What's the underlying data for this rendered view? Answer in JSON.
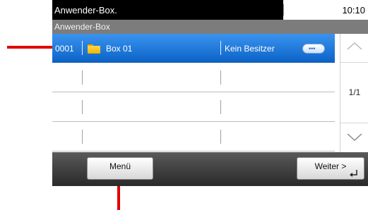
{
  "status": {
    "title": "Anwender-Box.",
    "time": "10:10"
  },
  "breadcrumb": "Anwender-Box",
  "rows": [
    {
      "number": "0001",
      "name": "Box 01",
      "owner": "Kein Besitzer",
      "selected": true
    },
    {
      "number": "",
      "name": "",
      "owner": "",
      "selected": false
    },
    {
      "number": "",
      "name": "",
      "owner": "",
      "selected": false
    },
    {
      "number": "",
      "name": "",
      "owner": "",
      "selected": false
    }
  ],
  "scroll": {
    "page_indicator": "1/1"
  },
  "buttons": {
    "menu_label": "Menü",
    "next_label": "Weiter >"
  },
  "icons": {
    "folder": "folder-icon",
    "detail": "detail-icon",
    "up": "scroll-up-icon",
    "down": "scroll-down-icon",
    "enter": "enter-icon"
  },
  "colors": {
    "selected_row": "#1a74de",
    "callout": "#e00000"
  }
}
